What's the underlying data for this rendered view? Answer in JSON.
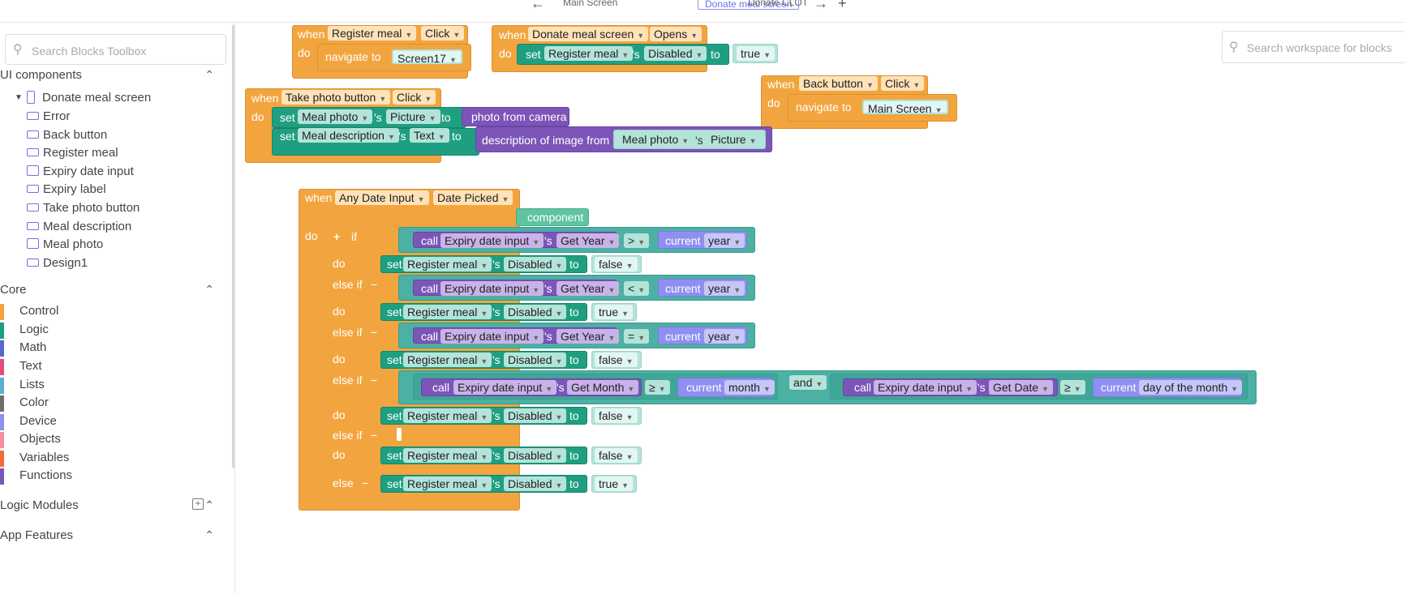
{
  "topbar": {
    "main_screen": "Main Screen",
    "donate_meal_screen": "Donate meal screen",
    "donate_clot": "Donate CLOT"
  },
  "sidebar": {
    "search_placeholder": "Search Blocks Toolbox",
    "ui_components": "UI components",
    "root": "Donate meal screen",
    "components": [
      "Error",
      "Back button",
      "Register meal",
      "Expiry date input",
      "Expiry label",
      "Take photo button",
      "Meal description",
      "Meal photo",
      "Design1"
    ],
    "core": "Core",
    "categories": [
      {
        "label": "Control",
        "color": "#f2a53f"
      },
      {
        "label": "Logic",
        "color": "#1f9f82"
      },
      {
        "label": "Math",
        "color": "#5b67c9"
      },
      {
        "label": "Text",
        "color": "#e0507a"
      },
      {
        "label": "Lists",
        "color": "#5aaed0"
      },
      {
        "label": "Color",
        "color": "#6e6e6e"
      },
      {
        "label": "Device",
        "color": "#8f8ff2"
      },
      {
        "label": "Objects",
        "color": "#f28fa0"
      },
      {
        "label": "Variables",
        "color": "#f56a3a"
      },
      {
        "label": "Functions",
        "color": "#7c55b8"
      }
    ],
    "logic_modules": "Logic Modules",
    "app_features": "App Features"
  },
  "workspace": {
    "search_placeholder": "Search workspace for blocks",
    "kw": {
      "when": "when",
      "do": "do",
      "set": "set",
      "s": "'s",
      "to": "to",
      "call": "call",
      "if": "if",
      "else_if": "else if",
      "else": "else",
      "and": "and",
      "plus": "+",
      "minus": "−",
      "navigate_to": "navigate to"
    },
    "b1": {
      "component": "Register meal",
      "event": "Click",
      "screen": "Screen17"
    },
    "b2": {
      "component": "Donate meal screen",
      "event": "Opens",
      "target": "Register meal",
      "prop": "Disabled",
      "value": "true"
    },
    "b3": {
      "component": "Back button",
      "event": "Click",
      "screen": "Main Screen"
    },
    "b4": {
      "component": "Take photo button",
      "event": "Click",
      "s1_target": "Meal photo",
      "s1_prop": "Picture",
      "s1_value": "photo from camera",
      "s2_target": "Meal description",
      "s2_prop": "Text",
      "s2_value": "description of image from",
      "s2_src": "Meal photo",
      "s2_src_prop": "Picture"
    },
    "b5": {
      "component": "Any Date Input",
      "event": "Date Picked",
      "param": "component",
      "comp": "Expiry date input",
      "get_year": "Get Year",
      "get_month": "Get Month",
      "get_date": "Get Date",
      "current": "current",
      "year": "year",
      "month": "month",
      "day": "day of the month",
      "op_gt": ">",
      "op_lt": "<",
      "op_eq": "=",
      "op_ge": "≥",
      "target": "Register meal",
      "prop": "Disabled",
      "v_false": "false",
      "v_true": "true"
    }
  }
}
